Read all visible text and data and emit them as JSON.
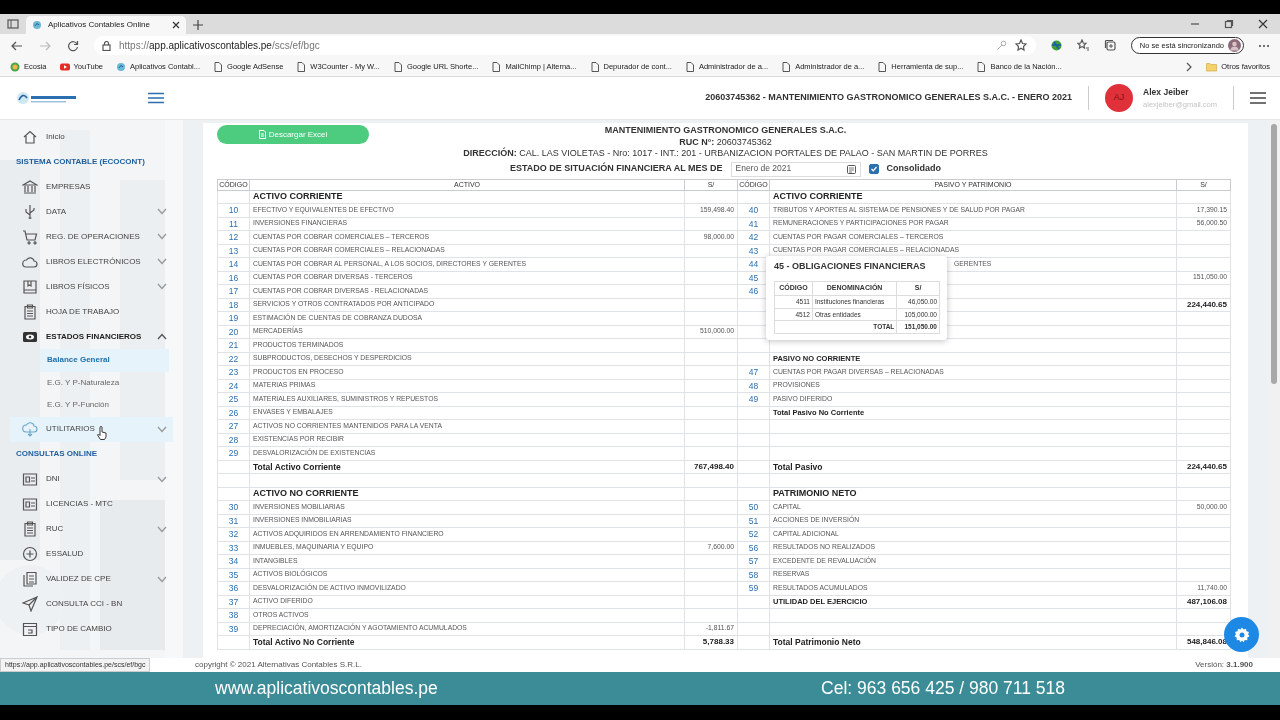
{
  "browser": {
    "tab_title": "Aplicativos Contables Online",
    "url": {
      "scheme": "https://",
      "host": "app.aplicativoscontables.pe",
      "path": "/scs/ef/bgc"
    },
    "sync_label": "No se está sincronizando",
    "bookmarks": [
      "Ecosia",
      "YouTube",
      "Aplicativos Contabl...",
      "Google AdSense",
      "W3Counter - My W...",
      "Google URL Shorte...",
      "MailChimp | Alterna...",
      "Depurador de cont...",
      "Administrador de a...",
      "Administrador de a...",
      "Herramienta de sup...",
      "Banco de la Nación..."
    ],
    "other_favorites": "Otros favoritos",
    "status_url": "https://app.aplicativoscontables.pe/scs/ef/bgc"
  },
  "header": {
    "company": "20603745362 - MANTENIMIENTO GASTRONOMICO GENERALES S.A.C. - ENERO 2021",
    "user": {
      "initials": "AJ",
      "name": "Alex Jeiber",
      "email": "alexjeiber@gmail.com"
    }
  },
  "sidebar": {
    "items": [
      {
        "kind": "link",
        "label": "Inicio",
        "active": false,
        "hovered": false
      },
      {
        "kind": "section",
        "label": "SISTEMA CONTABLE (ECOCONT)"
      },
      {
        "kind": "link",
        "label": "EMPRESAS",
        "active": false,
        "hovered": false
      },
      {
        "kind": "group",
        "label": "DATA",
        "expanded": false,
        "active": false,
        "hovered": false
      },
      {
        "kind": "group",
        "label": "REG. DE OPERACIONES",
        "expanded": false,
        "active": false,
        "hovered": false
      },
      {
        "kind": "group",
        "label": "LIBROS ELECTRÓNICOS",
        "expanded": false,
        "active": false,
        "hovered": false
      },
      {
        "kind": "group",
        "label": "LIBROS FÍSICOS",
        "expanded": false,
        "active": false,
        "hovered": false
      },
      {
        "kind": "link",
        "label": "HOJA DE TRABAJO",
        "active": false,
        "hovered": false
      },
      {
        "kind": "group",
        "label": "ESTADOS FINANCIEROS",
        "expanded": true,
        "active": true,
        "hovered": false,
        "children": [
          {
            "label": "Balance General",
            "selected": true
          },
          {
            "label": "E.G. Y P-Naturaleza",
            "selected": false
          },
          {
            "label": "E.G. Y P-Función",
            "selected": false
          }
        ]
      },
      {
        "kind": "group",
        "label": "UTILITARIOS",
        "expanded": false,
        "active": false,
        "hovered": true
      },
      {
        "kind": "section",
        "label": "CONSULTAS ONLINE"
      },
      {
        "kind": "group",
        "label": "DNI",
        "expanded": false,
        "active": false,
        "hovered": false
      },
      {
        "kind": "link",
        "label": "LICENCIAS - MTC",
        "active": false,
        "hovered": false
      },
      {
        "kind": "group",
        "label": "RUC",
        "expanded": false,
        "active": false,
        "hovered": false
      },
      {
        "kind": "link",
        "label": "ESSALUD",
        "active": false,
        "hovered": false
      },
      {
        "kind": "group",
        "label": "VALIDEZ DE CPE",
        "expanded": false,
        "active": false,
        "hovered": false
      },
      {
        "kind": "link",
        "label": "CONSULTA CCI - BN",
        "active": false,
        "hovered": false
      },
      {
        "kind": "link",
        "label": "TIPO DE CAMBIO",
        "active": false,
        "hovered": false
      }
    ]
  },
  "report": {
    "download_button": "Descargar Excel",
    "company": "MANTENIMIENTO GASTRONOMICO GENERALES S.A.C.",
    "ruc": "**RUC N°:** 20603745362",
    "address": "**DIRECCIÓN:** CAL. LAS VIOLETAS - Nro: 1017 - INT.: 201 - URBANIZACION PORTALES DE PALAO - SAN MARTIN DE PORRES",
    "period_label": "ESTADO DE SITUACIÓN FINANCIERA AL MES DE",
    "month": "Enero de 2021",
    "consolidated_label": "Consolidado",
    "consolidated": true
  },
  "table": {
    "columns": [
      "CÓDIGO",
      "ACTIVO",
      "S/",
      "CÓDIGO",
      "PASIVO Y PATRIMONIO",
      "S/"
    ],
    "rows": [
      {
        "left": {
          "kind": "section",
          "name": "ACTIVO CORRIENTE"
        },
        "right": {
          "kind": "section",
          "name": "ACTIVO CORRIENTE"
        }
      },
      {
        "left": {
          "kind": "item",
          "code": "10",
          "name": "EFECTIVO Y EQUIVALENTES DE EFECTIVO",
          "amount": "159,498.40"
        },
        "right": {
          "kind": "item",
          "code": "40",
          "name": "TRIBUTOS Y APORTES AL SISTEMA DE PENSIONES Y DE SALUD POR PAGAR",
          "amount": "17,390.15"
        }
      },
      {
        "left": {
          "kind": "item",
          "code": "11",
          "name": "INVERSIONES FINANCIERAS"
        },
        "right": {
          "kind": "item",
          "code": "41",
          "name": "REMUNERACIONES Y PARTICIPACIONES POR PAGAR",
          "amount": "56,000.50"
        }
      },
      {
        "left": {
          "kind": "item",
          "code": "12",
          "name": "CUENTAS POR COBRAR COMERCIALES – TERCEROS",
          "amount": "98,000.00"
        },
        "right": {
          "kind": "item",
          "code": "42",
          "name": "CUENTAS POR PAGAR COMERCIALES – TERCEROS"
        }
      },
      {
        "left": {
          "kind": "item",
          "code": "13",
          "name": "CUENTAS POR COBRAR COMERCIALES – RELACIONADAS"
        },
        "right": {
          "kind": "item",
          "code": "43",
          "name": "CUENTAS POR PAGAR COMERCIALES – RELACIONADAS"
        }
      },
      {
        "left": {
          "kind": "item",
          "code": "14",
          "name": "CUENTAS POR COBRAR AL PERSONAL, A LOS SOCIOS, DIRECTORES Y GERENTES"
        },
        "right": {
          "kind": "partial",
          "code": "44",
          "name": "GERENTES"
        }
      },
      {
        "left": {
          "kind": "item",
          "code": "16",
          "name": "CUENTAS POR COBRAR DIVERSAS - TERCEROS"
        },
        "right": {
          "kind": "item",
          "code": "45",
          "amount": "151,050.00"
        }
      },
      {
        "left": {
          "kind": "item",
          "code": "17",
          "name": "CUENTAS POR COBRAR DIVERSAS - RELACIONADAS"
        },
        "right": {
          "kind": "item",
          "code": "46"
        }
      },
      {
        "left": {
          "kind": "item",
          "code": "18",
          "name": "SERVICIOS Y OTROS CONTRATADOS POR ANTICIPADO"
        },
        "right": {
          "kind": "total",
          "amount": "224,440.65"
        }
      },
      {
        "left": {
          "kind": "item",
          "code": "19",
          "name": "ESTIMACIÓN DE CUENTAS DE COBRANZA DUDOSA"
        },
        "right": {
          "kind": "blank"
        }
      },
      {
        "left": {
          "kind": "item",
          "code": "20",
          "name": "MERCADERÍAS",
          "amount": "510,000.00"
        },
        "right": {
          "kind": "blank"
        }
      },
      {
        "left": {
          "kind": "item",
          "code": "21",
          "name": "PRODUCTOS TERMINADOS"
        },
        "right": {
          "kind": "blank"
        }
      },
      {
        "left": {
          "kind": "item",
          "code": "22",
          "name": "SUBPRODUCTOS, DESECHOS Y DESPERDICIOS"
        },
        "right": {
          "kind": "subsection",
          "name": "PASIVO NO CORRIENTE"
        }
      },
      {
        "left": {
          "kind": "item",
          "code": "23",
          "name": "PRODUCTOS EN PROCESO"
        },
        "right": {
          "kind": "item",
          "code": "47",
          "name": "CUENTAS POR PAGAR DIVERSAS – RELACIONADAS"
        }
      },
      {
        "left": {
          "kind": "item",
          "code": "24",
          "name": "MATERIAS PRIMAS"
        },
        "right": {
          "kind": "item",
          "code": "48",
          "name": "PROVISIONES"
        }
      },
      {
        "left": {
          "kind": "item",
          "code": "25",
          "name": "MATERIALES AUXILIARES, SUMINISTROS Y REPUESTOS"
        },
        "right": {
          "kind": "item",
          "code": "49",
          "name": "PASIVO DIFERIDO"
        }
      },
      {
        "left": {
          "kind": "item",
          "code": "26",
          "name": "ENVASES Y EMBALAJES"
        },
        "right": {
          "kind": "subtotal",
          "name": "Total Pasivo No Corriente"
        }
      },
      {
        "left": {
          "kind": "item",
          "code": "27",
          "name": "ACTIVOS NO CORRIENTES MANTENIDOS PARA LA VENTA"
        },
        "right": {
          "kind": "blank"
        }
      },
      {
        "left": {
          "kind": "item",
          "code": "28",
          "name": "EXISTENCIAS POR RECIBIR"
        },
        "right": {
          "kind": "blank"
        }
      },
      {
        "left": {
          "kind": "item",
          "code": "29",
          "name": "DESVALORIZACIÓN DE EXISTENCIAS"
        },
        "right": {
          "kind": "blank"
        }
      },
      {
        "left": {
          "kind": "total",
          "name": "Total Activo Corriente",
          "amount": "767,498.40"
        },
        "right": {
          "kind": "total",
          "name": "Total Pasivo",
          "amount": "224,440.65"
        }
      },
      {
        "left": {
          "kind": "spacer"
        },
        "right": {
          "kind": "spacer"
        }
      },
      {
        "left": {
          "kind": "section",
          "name": "ACTIVO NO CORRIENTE"
        },
        "right": {
          "kind": "section",
          "name": "PATRIMONIO NETO"
        }
      },
      {
        "left": {
          "kind": "item",
          "code": "30",
          "name": "INVERSIONES MOBILIARIAS"
        },
        "right": {
          "kind": "item",
          "code": "50",
          "name": "CAPITAL",
          "amount": "50,000.00"
        }
      },
      {
        "left": {
          "kind": "item",
          "code": "31",
          "name": "INVERSIONES INMOBILIARIAS"
        },
        "right": {
          "kind": "item",
          "code": "51",
          "name": "ACCIONES DE INVERSIÓN"
        }
      },
      {
        "left": {
          "kind": "item",
          "code": "32",
          "name": "ACTIVOS ADQUIRIDOS EN ARRENDAMIENTO FINANCIERO"
        },
        "right": {
          "kind": "item",
          "code": "52",
          "name": "CAPITAL ADICIONAL"
        }
      },
      {
        "left": {
          "kind": "item",
          "code": "33",
          "name": "INMUEBLES, MAQUINARIA Y EQUIPO",
          "amount": "7,600.00"
        },
        "right": {
          "kind": "item",
          "code": "56",
          "name": "RESULTADOS NO REALIZADOS"
        }
      },
      {
        "left": {
          "kind": "item",
          "code": "34",
          "name": "INTANGIBLES"
        },
        "right": {
          "kind": "item",
          "code": "57",
          "name": "EXCEDENTE DE REVALUACIÓN"
        }
      },
      {
        "left": {
          "kind": "item",
          "code": "35",
          "name": "ACTIVOS BIOLÓGICOS"
        },
        "right": {
          "kind": "item",
          "code": "58",
          "name": "RESERVAS"
        }
      },
      {
        "left": {
          "kind": "item",
          "code": "36",
          "name": "DESVALORIZACIÓN DE ACTIVO INMOVILIZADO"
        },
        "right": {
          "kind": "item",
          "code": "59",
          "name": "RESULTADOS ACUMULADOS",
          "amount": "11,740.00"
        }
      },
      {
        "left": {
          "kind": "item",
          "code": "37",
          "name": "ACTIVO DIFERIDO"
        },
        "right": {
          "kind": "subtotal",
          "name": "UTILIDAD DEL EJERCICIO",
          "amount": "487,106.08"
        }
      },
      {
        "left": {
          "kind": "item",
          "code": "38",
          "name": "OTROS ACTIVOS"
        },
        "right": {
          "kind": "blank"
        }
      },
      {
        "left": {
          "kind": "item",
          "code": "39",
          "name": "DEPRECIACIÓN, AMORTIZACIÓN Y AGOTAMIENTO ACUMULADOS",
          "amount": "-1,811.67"
        },
        "right": {
          "kind": "blank"
        }
      },
      {
        "left": {
          "kind": "total",
          "name": "Total Activo No Corriente",
          "amount": "5,788.33"
        },
        "right": {
          "kind": "total",
          "name": "Total Patrimonio Neto",
          "amount": "548,846.08"
        }
      }
    ]
  },
  "popover": {
    "title": "45 - OBLIGACIONES FINANCIERAS",
    "columns": [
      "CÓDIGO",
      "DENOMINACIÓN",
      "S/"
    ],
    "rows": [
      {
        "code": "4511",
        "name": "Instituciones financieras",
        "amount": "46,050.00"
      },
      {
        "code": "4512",
        "name": "Otras entidades",
        "amount": "105,000.00"
      }
    ],
    "total_label": "TOTAL",
    "total": "151,050.00"
  },
  "footer": {
    "copyright": "copyright © 2021 ",
    "company_link": "Alternativas Contables S.R.L.",
    "version": "Versión: **3.1.900**"
  },
  "banner": {
    "website": "www.aplicativoscontables.pe",
    "phones": "Cel: 963 656 425 / 980 711 518"
  }
}
